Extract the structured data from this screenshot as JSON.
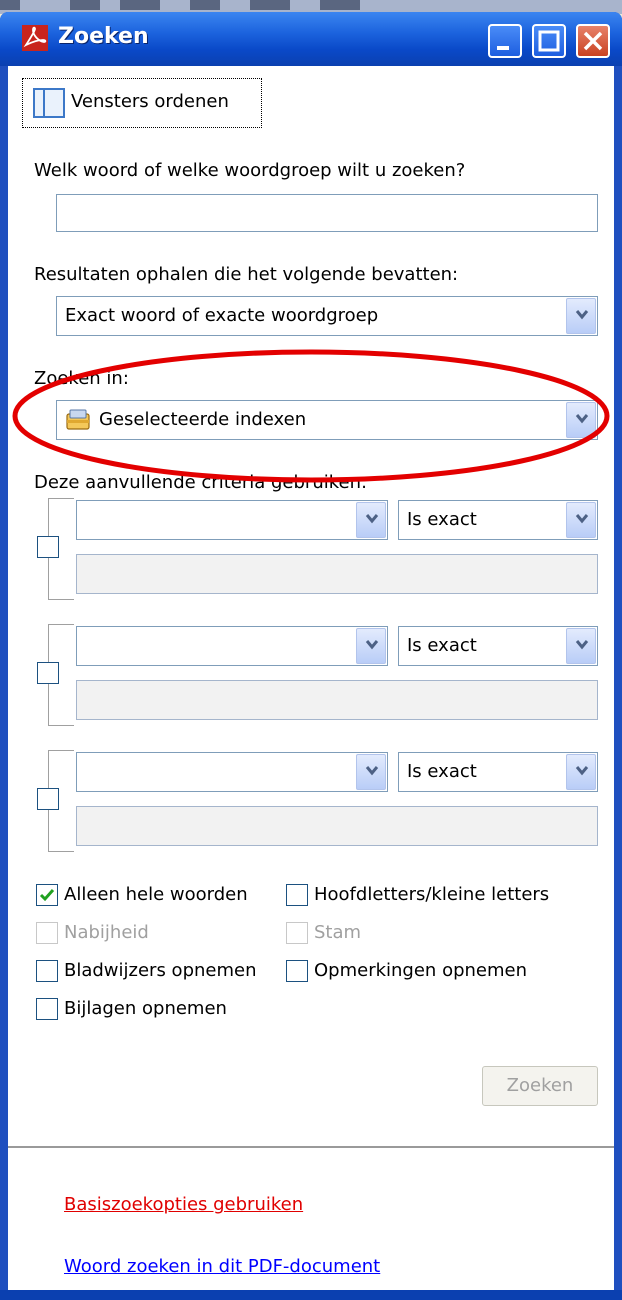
{
  "window": {
    "title": "Zoeken"
  },
  "arrange_button": {
    "label": "Vensters ordenen"
  },
  "search": {
    "question_label": "Welk woord of welke woordgroep wilt u zoeken?",
    "query_value": ""
  },
  "results": {
    "label": "Resultaten ophalen die het volgende bevatten:",
    "selected": "Exact woord of exacte woordgroep"
  },
  "search_in": {
    "label": "Zoeken in:",
    "selected": "Geselecteerde indexen"
  },
  "criteria": {
    "label": "Deze aanvullende criteria gebruiken:",
    "rows": [
      {
        "field": "",
        "operator": "Is exact",
        "value": "",
        "checked": false
      },
      {
        "field": "",
        "operator": "Is exact",
        "value": "",
        "checked": false
      },
      {
        "field": "",
        "operator": "Is exact",
        "value": "",
        "checked": false
      }
    ]
  },
  "options": {
    "whole_words": {
      "label": "Alleen hele woorden",
      "checked": true,
      "enabled": true
    },
    "case_sensitive": {
      "label": "Hoofdletters/kleine letters",
      "checked": false,
      "enabled": true
    },
    "proximity": {
      "label": "Nabijheid",
      "checked": false,
      "enabled": false
    },
    "stemming": {
      "label": "Stam",
      "checked": false,
      "enabled": false
    },
    "bookmarks": {
      "label": "Bladwijzers opnemen",
      "checked": false,
      "enabled": true
    },
    "comments": {
      "label": "Opmerkingen opnemen",
      "checked": false,
      "enabled": true
    },
    "attachments": {
      "label": "Bijlagen opnemen",
      "checked": false,
      "enabled": true
    }
  },
  "search_button": {
    "label": "Zoeken",
    "enabled": false
  },
  "links": {
    "basic_search": "Basiszoekopties gebruiken",
    "find_in_document": "Woord zoeken in dit PDF-document"
  },
  "colors": {
    "highlight_ellipse": "#e30000",
    "link_red": "#e00000",
    "link_blue": "#0000ff",
    "title_bar": "#0a49c8"
  }
}
